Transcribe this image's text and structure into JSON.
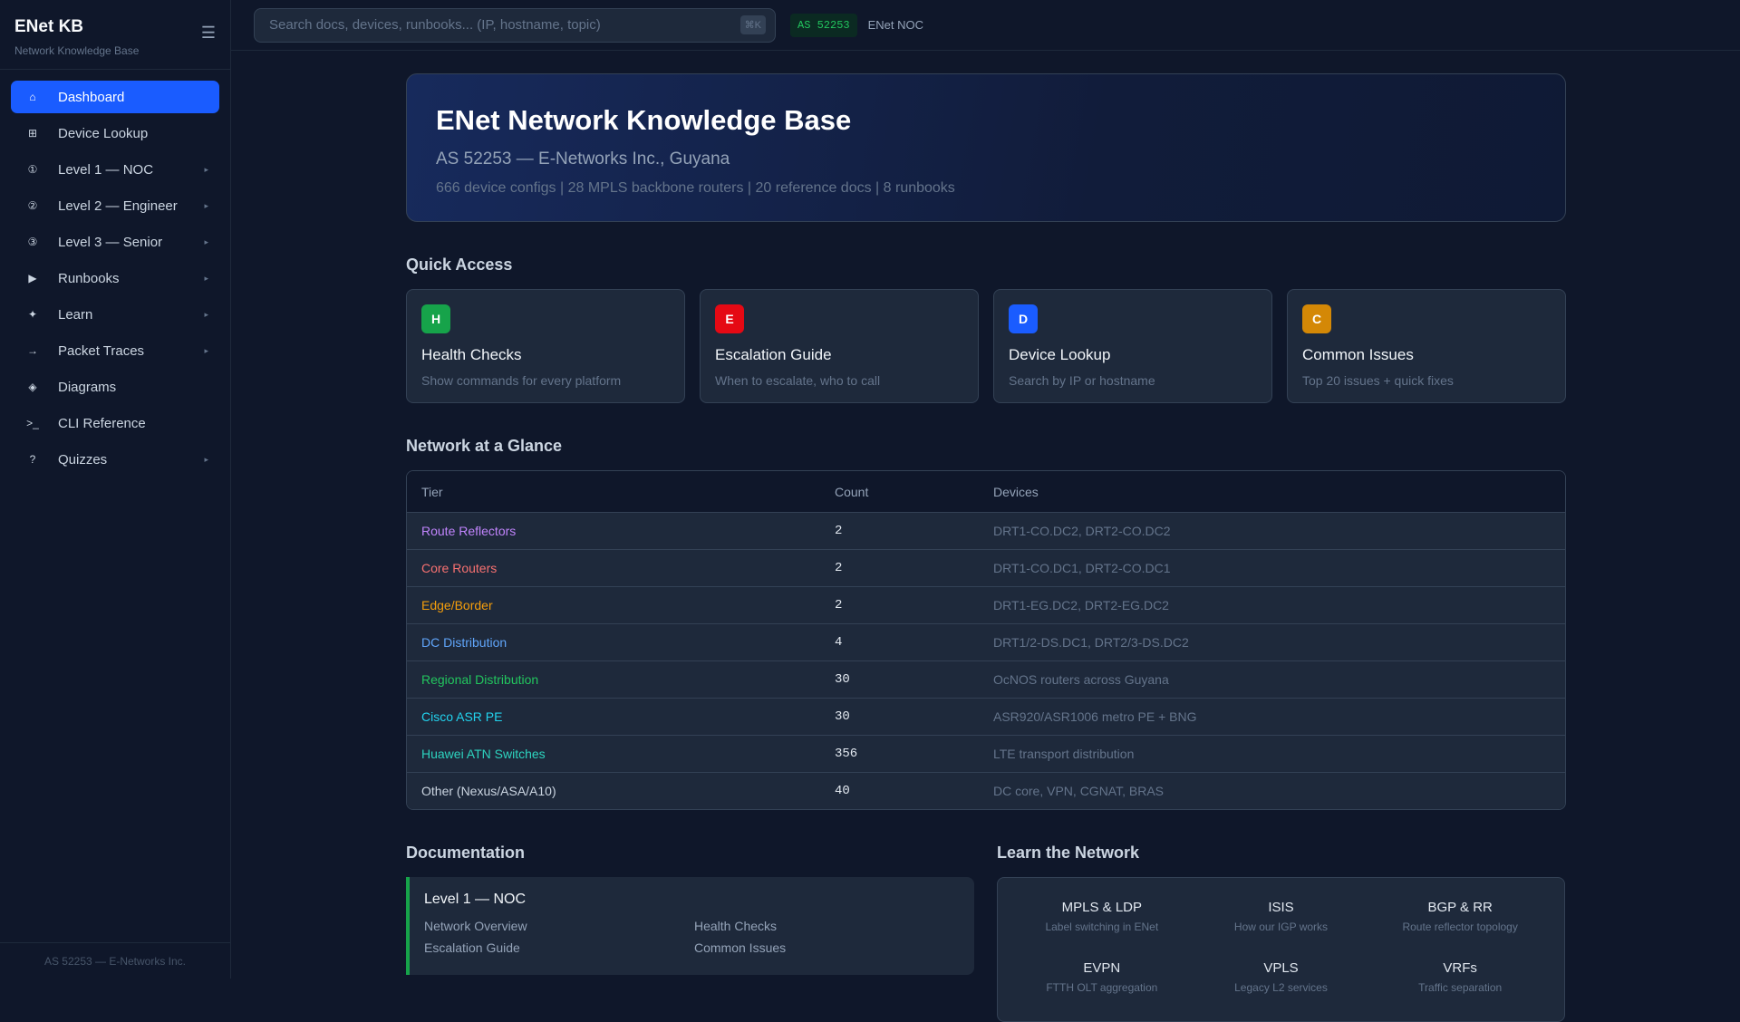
{
  "sidebar": {
    "title": "ENet KB",
    "subtitle": "Network Knowledge Base",
    "footer": "AS 52253 — E-Networks Inc.",
    "items": [
      {
        "icon": "⌂",
        "label": "Dashboard",
        "arrow": ""
      },
      {
        "icon": "⊞",
        "label": "Device Lookup",
        "arrow": ""
      },
      {
        "icon": "①",
        "label": "Level 1 — NOC",
        "arrow": "▸"
      },
      {
        "icon": "②",
        "label": "Level 2 — Engineer",
        "arrow": "▸"
      },
      {
        "icon": "③",
        "label": "Level 3 — Senior",
        "arrow": "▸"
      },
      {
        "icon": "▶",
        "label": "Runbooks",
        "arrow": "▸"
      },
      {
        "icon": "✦",
        "label": "Learn",
        "arrow": "▸"
      },
      {
        "icon": "→",
        "label": "Packet Traces",
        "arrow": "▸"
      },
      {
        "icon": "◈",
        "label": "Diagrams",
        "arrow": ""
      },
      {
        "icon": ">_",
        "label": "CLI Reference",
        "arrow": ""
      },
      {
        "icon": "?",
        "label": "Quizzes",
        "arrow": "▸"
      }
    ]
  },
  "topbar": {
    "search_placeholder": "Search docs, devices, runbooks... (IP, hostname, topic)",
    "shortcut": "⌘K",
    "as_badge": "AS 52253",
    "noc": "ENet NOC"
  },
  "hero": {
    "title": "ENet Network Knowledge Base",
    "subtitle": "AS 52253 — E-Networks Inc., Guyana",
    "stats": "666 device configs | 28 MPLS backbone routers | 20 reference docs | 8 runbooks"
  },
  "quick_access": {
    "heading": "Quick Access",
    "cards": [
      {
        "letter": "H",
        "color": "#16a34a",
        "title": "Health Checks",
        "desc": "Show commands for every platform"
      },
      {
        "letter": "E",
        "color": "#e50914",
        "title": "Escalation Guide",
        "desc": "When to escalate, who to call"
      },
      {
        "letter": "D",
        "color": "#1a5cff",
        "title": "Device Lookup",
        "desc": "Search by IP or hostname"
      },
      {
        "letter": "C",
        "color": "#d48806",
        "title": "Common Issues",
        "desc": "Top 20 issues + quick fixes"
      }
    ]
  },
  "glance": {
    "heading": "Network at a Glance",
    "headers": [
      "Tier",
      "Count",
      "Devices"
    ],
    "rows": [
      {
        "tier": "Route Reflectors",
        "color": "#c084fc",
        "count": "2",
        "devices": "DRT1-CO.DC2, DRT2-CO.DC2"
      },
      {
        "tier": "Core Routers",
        "color": "#f87171",
        "count": "2",
        "devices": "DRT1-CO.DC1, DRT2-CO.DC1"
      },
      {
        "tier": "Edge/Border",
        "color": "#f59e0b",
        "count": "2",
        "devices": "DRT1-EG.DC2, DRT2-EG.DC2"
      },
      {
        "tier": "DC Distribution",
        "color": "#60a5fa",
        "count": "4",
        "devices": "DRT1/2-DS.DC1, DRT2/3-DS.DC2"
      },
      {
        "tier": "Regional Distribution",
        "color": "#22c55e",
        "count": "30",
        "devices": "OcNOS routers across Guyana"
      },
      {
        "tier": "Cisco ASR PE",
        "color": "#22d3ee",
        "count": "30",
        "devices": "ASR920/ASR1006 metro PE + BNG"
      },
      {
        "tier": "Huawei ATN Switches",
        "color": "#2dd4bf",
        "count": "356",
        "devices": "LTE transport distribution"
      },
      {
        "tier": "Other (Nexus/ASA/A10)",
        "color": "#cbd5e1",
        "count": "40",
        "devices": "DC core, VPN, CGNAT, BRAS"
      }
    ]
  },
  "documentation": {
    "heading": "Documentation",
    "card_title": "Level 1 — NOC",
    "links": [
      "Network Overview",
      "Health Checks",
      "Escalation Guide",
      "Common Issues"
    ]
  },
  "learn": {
    "heading": "Learn the Network",
    "topics": [
      {
        "title": "MPLS & LDP",
        "desc": "Label switching in ENet"
      },
      {
        "title": "ISIS",
        "desc": "How our IGP works"
      },
      {
        "title": "BGP & RR",
        "desc": "Route reflector topology"
      },
      {
        "title": "EVPN",
        "desc": "FTTH OLT aggregation"
      },
      {
        "title": "VPLS",
        "desc": "Legacy L2 services"
      },
      {
        "title": "VRFs",
        "desc": "Traffic separation"
      }
    ]
  }
}
